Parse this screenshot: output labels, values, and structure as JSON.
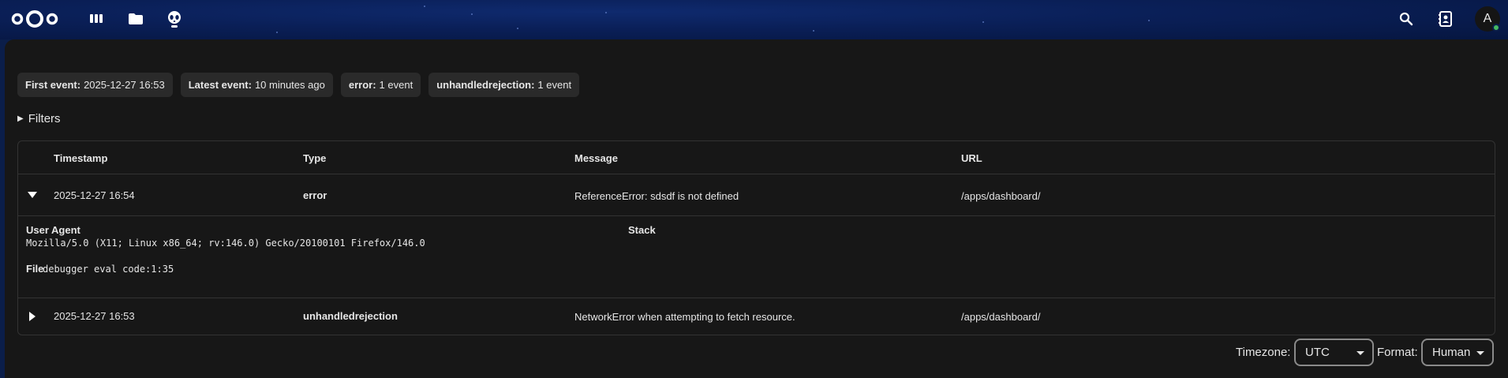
{
  "header": {
    "apps": [
      {
        "name": "dashboard",
        "icon": "dashboard-icon"
      },
      {
        "name": "files",
        "icon": "folder-icon"
      },
      {
        "name": "logreader",
        "icon": "alien-icon"
      }
    ],
    "search_icon": "search-icon",
    "contacts_icon": "contacts-icon",
    "avatar_initial": "A"
  },
  "summary": {
    "first_event": {
      "label": "First event:",
      "value": "2025-12-27 16:53"
    },
    "latest_event": {
      "label": "Latest event:",
      "value": "10 minutes ago"
    },
    "error": {
      "label": "error:",
      "value": "1 event"
    },
    "unhandled": {
      "label": "unhandledrejection:",
      "value": "1 event"
    }
  },
  "filters_label": "Filters",
  "table": {
    "columns": [
      "Timestamp",
      "Type",
      "Message",
      "URL"
    ],
    "rows": [
      {
        "timestamp": "2025-12-27 16:54",
        "type": "error",
        "message": "ReferenceError: sdsdf is not defined",
        "url": "/apps/dashboard/",
        "expanded": true,
        "detail": {
          "user_agent_label": "User Agent",
          "user_agent": "Mozilla/5.0 (X11; Linux x86_64; rv:146.0) Gecko/20100101 Firefox/146.0",
          "stack_label": "Stack",
          "file_label": "File",
          "file": "debugger eval code:1:35"
        }
      },
      {
        "timestamp": "2025-12-27 16:53",
        "type": "unhandledrejection",
        "message": "NetworkError when attempting to fetch resource.",
        "url": "/apps/dashboard/",
        "expanded": false
      }
    ]
  },
  "footer": {
    "timezone_label": "Timezone:",
    "timezone_value": "UTC",
    "format_label": "Format:",
    "format_value": "Human"
  },
  "colors": {
    "header_bg": "#0a1f57",
    "panel_bg": "#171717",
    "badge_bg": "#2a2a2a",
    "status_online": "#46ba61"
  }
}
